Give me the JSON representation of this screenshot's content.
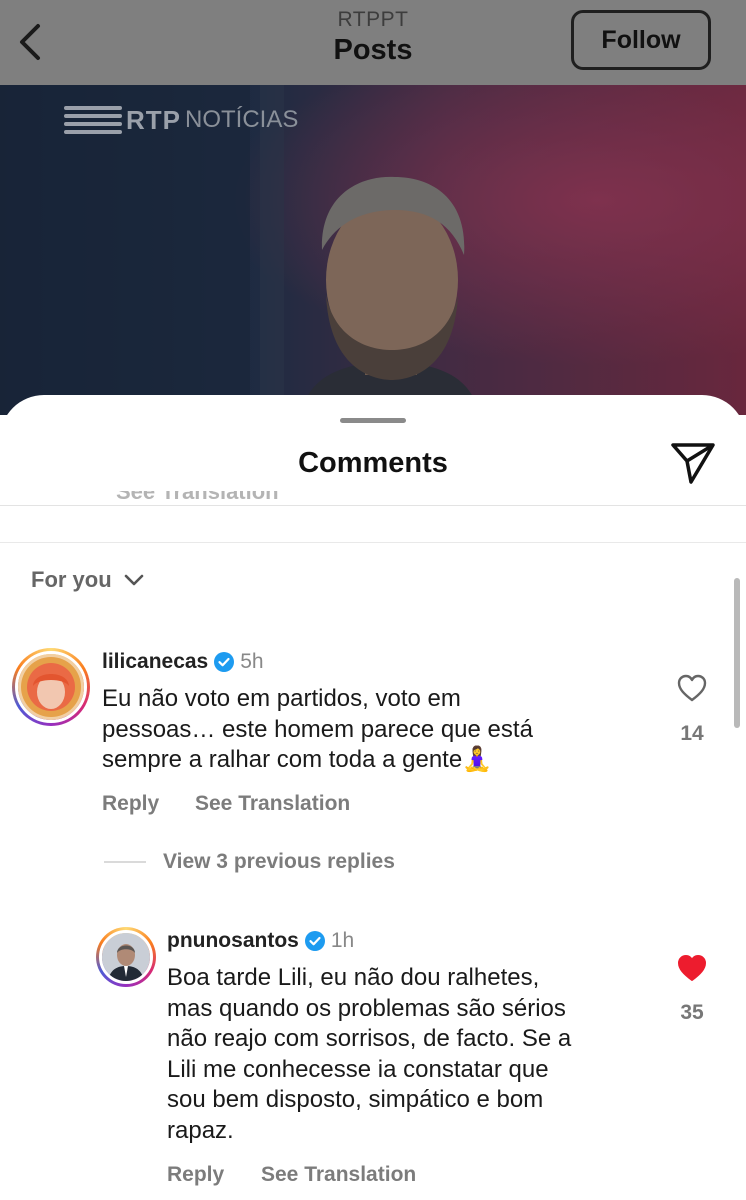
{
  "header": {
    "account": "RTPPT",
    "title": "Posts",
    "follow_label": "Follow"
  },
  "hero": {
    "logo_rtp": "RTP",
    "logo_news": "NOTÍCIAS"
  },
  "comments_sheet": {
    "title": "Comments",
    "ghost_text": "See Translation",
    "filter_label": "For you"
  },
  "comments": [
    {
      "username": "lilicanecas",
      "time": "5h",
      "lines": [
        "Eu não voto em partidos, voto em",
        "pessoas… este homem parece que está",
        "sempre a ralhar com toda a gente🧘‍♀️"
      ],
      "likes": "14",
      "liked": false,
      "reply_label": "Reply",
      "translate_label": "See Translation"
    }
  ],
  "view_replies": "View 3 previous replies",
  "replies": [
    {
      "username": "pnunosantos",
      "time": "1h",
      "lines": [
        "Boa tarde Lili, eu não dou ralhetes,",
        "mas quando os problemas são sérios",
        "não reajo com sorrisos, de facto. Se a",
        "Lili me conhecesse ia constatar que",
        "sou bem disposto, simpático e bom",
        "rapaz."
      ],
      "likes": "35",
      "liked": true,
      "reply_label": "Reply",
      "translate_label": "See Translation"
    }
  ],
  "colors": {
    "liked_heart": "#ed1c2e",
    "verified": "#1d9bf0",
    "header_overlay": "#7f7f7f"
  }
}
